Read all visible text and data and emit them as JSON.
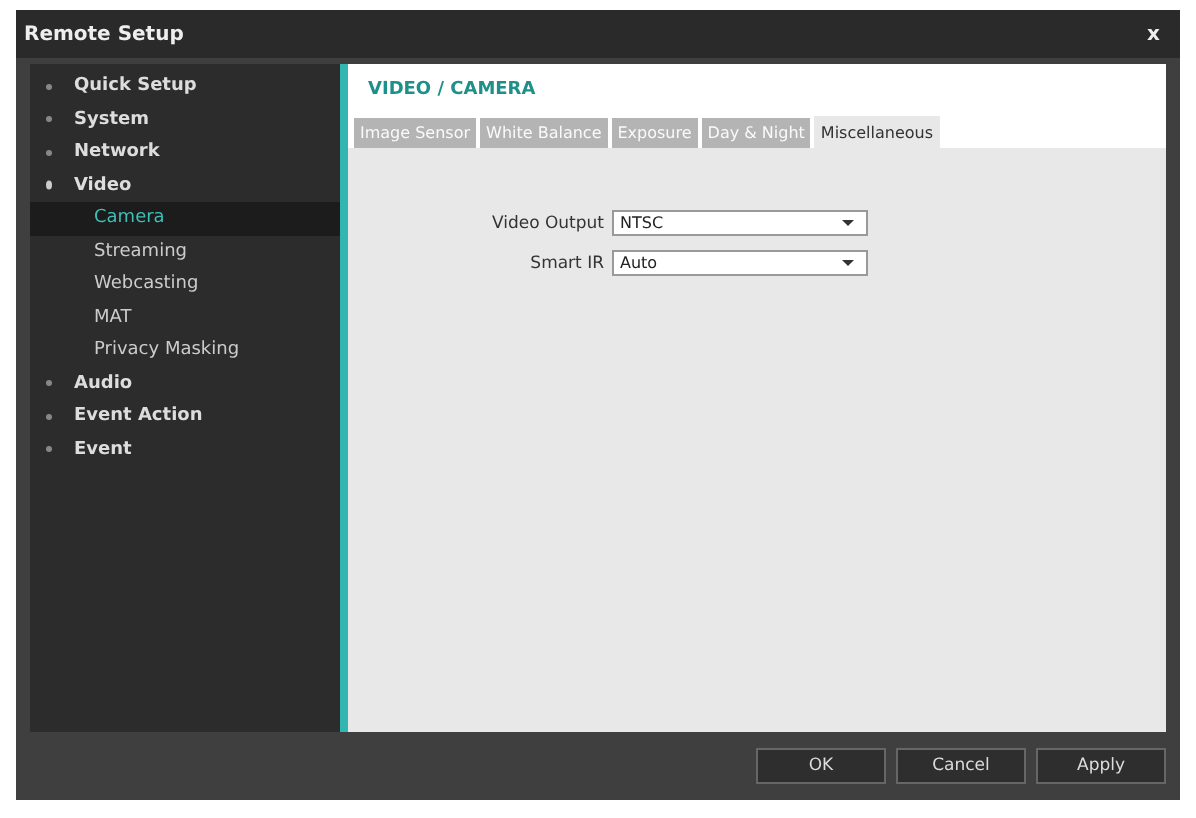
{
  "window": {
    "title": "Remote Setup",
    "close": "x"
  },
  "sidebar": {
    "items": [
      {
        "label": "Quick Setup",
        "expanded": false,
        "selected": false
      },
      {
        "label": "System",
        "expanded": false,
        "selected": false
      },
      {
        "label": "Network",
        "expanded": false,
        "selected": false
      },
      {
        "label": "Video",
        "expanded": true,
        "selected": false,
        "children": [
          {
            "label": "Camera",
            "selected": true
          },
          {
            "label": "Streaming",
            "selected": false
          },
          {
            "label": "Webcasting",
            "selected": false
          },
          {
            "label": "MAT",
            "selected": false
          },
          {
            "label": "Privacy Masking",
            "selected": false
          }
        ]
      },
      {
        "label": "Audio",
        "expanded": false,
        "selected": false
      },
      {
        "label": "Event Action",
        "expanded": false,
        "selected": false
      },
      {
        "label": "Event",
        "expanded": false,
        "selected": false
      }
    ]
  },
  "content": {
    "heading": "VIDEO / CAMERA",
    "tabs": [
      {
        "label": "Image Sensor",
        "selected": false
      },
      {
        "label": "White Balance",
        "selected": false
      },
      {
        "label": "Exposure",
        "selected": false
      },
      {
        "label": "Day & Night",
        "selected": false
      },
      {
        "label": "Miscellaneous",
        "selected": true
      }
    ],
    "fields": [
      {
        "label": "Video Output",
        "value": "NTSC"
      },
      {
        "label": "Smart IR",
        "value": "Auto"
      }
    ]
  },
  "buttons": [
    "OK",
    "Cancel",
    "Apply"
  ]
}
